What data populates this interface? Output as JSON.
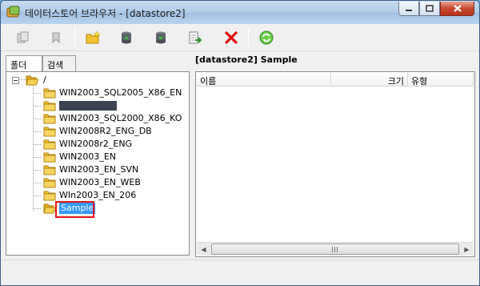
{
  "window": {
    "title": "데이터스토어 브라우저 - [datastore2]",
    "buttons": {
      "minimize_icon": "minimize-icon",
      "maximize_icon": "maximize-icon",
      "close_icon": "close-icon"
    }
  },
  "toolbar": {
    "buttons": [
      {
        "name": "copy-button",
        "icon": "copy-icon",
        "enabled": false
      },
      {
        "name": "back-button",
        "icon": "back-icon",
        "enabled": false
      },
      {
        "name": "new-folder-button",
        "icon": "new-folder-icon",
        "enabled": true
      },
      {
        "name": "upload-button",
        "icon": "upload-icon",
        "enabled": true
      },
      {
        "name": "download-button",
        "icon": "download-icon",
        "enabled": true
      },
      {
        "name": "register-button",
        "icon": "register-icon",
        "enabled": true
      },
      {
        "name": "delete-button",
        "icon": "delete-icon",
        "enabled": true,
        "color": "#e01010"
      },
      {
        "name": "refresh-button",
        "icon": "refresh-icon",
        "enabled": true,
        "color": "#2fa52f"
      }
    ]
  },
  "tabs": [
    {
      "label": "폴더",
      "active": true
    },
    {
      "label": "검색",
      "active": false
    }
  ],
  "tree": {
    "root": "/",
    "children": [
      "WIN2003_SQL2005_X86_EN",
      "",
      "WIN2003_SQL2000_X86_KO",
      "WIN2008R2_ENG_DB",
      "WIN2008r2_ENG",
      "WIN2003_EN",
      "WIN2003_EN_SVN",
      "WIN2003_EN_WEB",
      "WIn2003_EN_206",
      "Sample"
    ],
    "selected": "Sample",
    "redacted_index": 1
  },
  "right_panel": {
    "title": "[datastore2] Sample",
    "columns": [
      "이름",
      "크기",
      "유형"
    ]
  },
  "colors": {
    "selection": "#3399ff",
    "highlight_box": "#e0141b",
    "folder": "#f2c230"
  }
}
